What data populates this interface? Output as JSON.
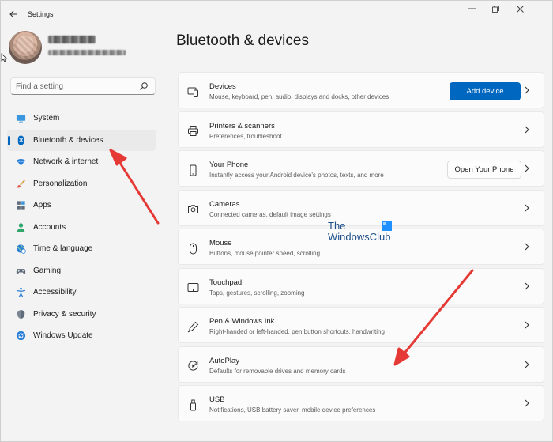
{
  "window": {
    "title": "Settings",
    "controls": {
      "minimize": "—",
      "maximize": "❐",
      "close": "✕"
    }
  },
  "search": {
    "placeholder": "Find a setting"
  },
  "sidebar": {
    "items": [
      {
        "label": "System",
        "icon": "monitor-icon"
      },
      {
        "label": "Bluetooth & devices",
        "icon": "bluetooth-icon",
        "active": true
      },
      {
        "label": "Network & internet",
        "icon": "wifi-icon"
      },
      {
        "label": "Personalization",
        "icon": "brush-icon"
      },
      {
        "label": "Apps",
        "icon": "apps-icon"
      },
      {
        "label": "Accounts",
        "icon": "person-icon"
      },
      {
        "label": "Time & language",
        "icon": "globe-clock-icon"
      },
      {
        "label": "Gaming",
        "icon": "gamepad-icon"
      },
      {
        "label": "Accessibility",
        "icon": "accessibility-icon"
      },
      {
        "label": "Privacy & security",
        "icon": "shield-icon"
      },
      {
        "label": "Windows Update",
        "icon": "update-icon"
      }
    ]
  },
  "main": {
    "title": "Bluetooth & devices",
    "cards": [
      {
        "title": "Devices",
        "description": "Mouse, keyboard, pen, audio, displays and docks, other devices",
        "button": "Add device",
        "icon": "devices-icon"
      },
      {
        "title": "Printers & scanners",
        "description": "Preferences, troubleshoot",
        "icon": "printer-icon"
      },
      {
        "title": "Your Phone",
        "description": "Instantly access your Android device's photos, texts, and more",
        "button": "Open Your Phone",
        "icon": "phone-icon"
      },
      {
        "title": "Cameras",
        "description": "Connected cameras, default image settings",
        "icon": "camera-icon"
      },
      {
        "title": "Mouse",
        "description": "Buttons, mouse pointer speed, scrolling",
        "icon": "mouse-icon"
      },
      {
        "title": "Touchpad",
        "description": "Taps, gestures, scrolling, zooming",
        "icon": "touchpad-icon"
      },
      {
        "title": "Pen & Windows Ink",
        "description": "Right-handed or left-handed, pen button shortcuts, handwriting",
        "icon": "pen-icon"
      },
      {
        "title": "AutoPlay",
        "description": "Defaults for removable drives and memory cards",
        "icon": "autoplay-icon"
      },
      {
        "title": "USB",
        "description": "Notifications, USB battery saver, mobile device preferences",
        "icon": "usb-icon"
      }
    ]
  },
  "watermark": {
    "line1": "The",
    "line2": "WindowsClub"
  },
  "colors": {
    "accent": "#0067c0",
    "arrow": "#e53935",
    "background": "#f3f3f3",
    "card": "#fbfbfb"
  }
}
